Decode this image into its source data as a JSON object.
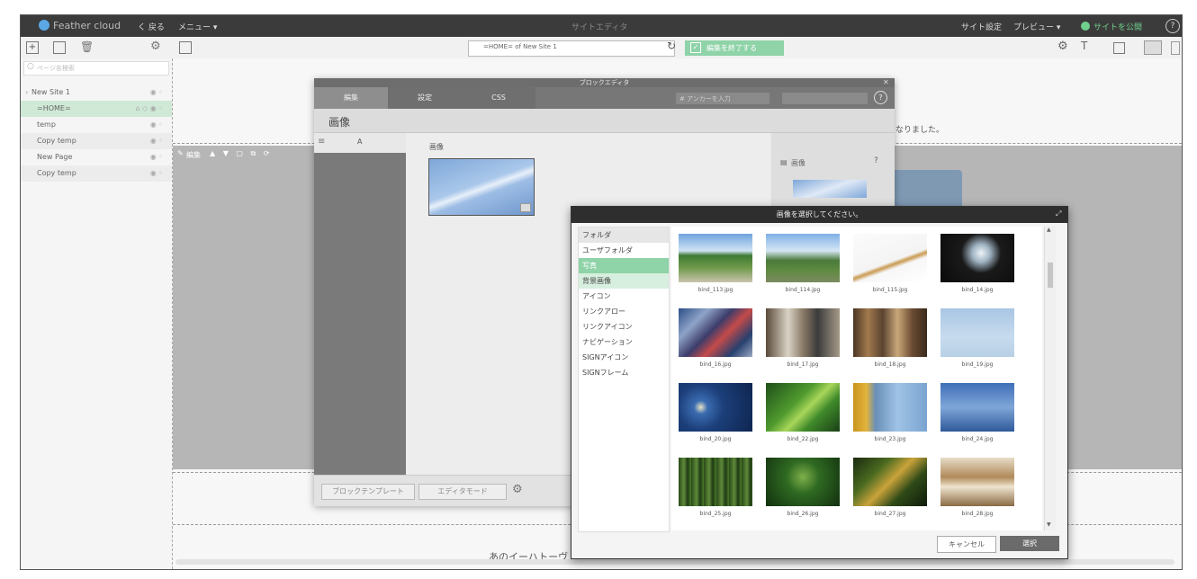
{
  "topbar": {
    "logo": "Feather cloud",
    "back": "く 戻る",
    "menu": "メニュー ▾",
    "center_title": "サイトエディタ",
    "site_settings": "サイト設定",
    "preview": "プレビュー ▾",
    "publish": "サイトを公開",
    "help": "?"
  },
  "toolbar": {
    "url": "=HOME= of New Site 1",
    "finish_edit": "編集を終了する"
  },
  "page_panel": {
    "search_placeholder": "ページ名検索",
    "pages": [
      {
        "label": "New Site 1",
        "selected": false
      },
      {
        "label": "=HOME=",
        "selected": true
      },
      {
        "label": "temp",
        "selected": false
      },
      {
        "label": "Copy temp",
        "selected": false
      },
      {
        "label": "New Page",
        "selected": false
      },
      {
        "label": "Copy temp",
        "selected": false
      }
    ]
  },
  "canvas": {
    "block_toolbar_label": "編集",
    "right_text": "なりました。",
    "bottom_text": "あのイーハトーヴ"
  },
  "block_editor": {
    "title": "ブロックエディタ",
    "tabs": [
      "編集",
      "設定",
      "CSS"
    ],
    "anchor_placeholder": "# アンカーを入力",
    "heading": "画像",
    "left_item": "A",
    "main_label": "画像",
    "right_label": "画像",
    "footer_template": "ブロックテンプレート",
    "footer_mode": "エディタモード"
  },
  "image_picker": {
    "title": "画像を選択してください。",
    "folders": [
      {
        "label": "フォルダ",
        "state": "header"
      },
      {
        "label": "ユーザフォルダ",
        "state": "normal"
      },
      {
        "label": "写真",
        "state": "active"
      },
      {
        "label": "背景画像",
        "state": "light"
      },
      {
        "label": "アイコン",
        "state": "normal"
      },
      {
        "label": "リンクアロー",
        "state": "normal"
      },
      {
        "label": "リンクアイコン",
        "state": "normal"
      },
      {
        "label": "ナビゲーション",
        "state": "normal"
      },
      {
        "label": "SIGNアイコン",
        "state": "normal"
      },
      {
        "label": "SIGNフレーム",
        "state": "normal"
      }
    ],
    "images": [
      "bind_113.jpg",
      "bind_114.jpg",
      "bind_115.jpg",
      "bind_14.jpg",
      "bind_16.jpg",
      "bind_17.jpg",
      "bind_18.jpg",
      "bind_19.jpg",
      "bind_20.jpg",
      "bind_22.jpg",
      "bind_23.jpg",
      "bind_24.jpg",
      "bind_25.jpg",
      "bind_26.jpg",
      "bind_27.jpg",
      "bind_28.jpg"
    ],
    "cancel": "キャンセル",
    "select": "選択"
  },
  "colors": {
    "accent_green": "#8fd3a8",
    "topbar": "#3b3b3b"
  }
}
